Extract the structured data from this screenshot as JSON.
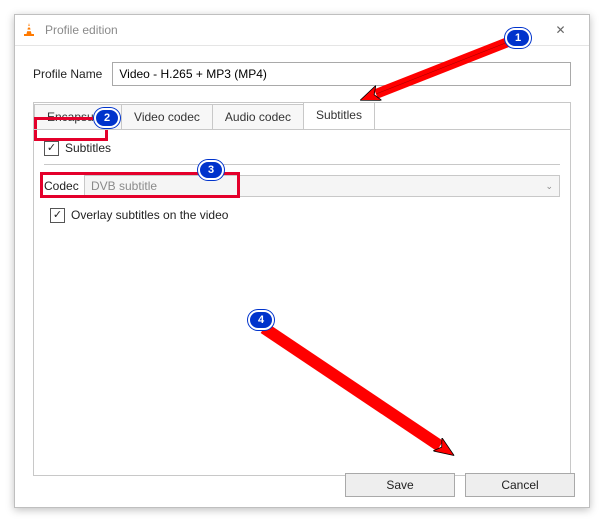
{
  "window": {
    "title": "Profile edition",
    "profile_label": "Profile Name",
    "profile_value": "Video - H.265 + MP3 (MP4)"
  },
  "tabs": {
    "encapsulation": "Encapsulati",
    "video_codec": "Video codec",
    "audio_codec": "Audio codec",
    "subtitles": "Subtitles"
  },
  "subtitles_panel": {
    "subtitles_checkbox_label": "Subtitles",
    "codec_label": "Codec",
    "codec_value": "DVB subtitle",
    "overlay_checkbox_label": "Overlay subtitles on the video"
  },
  "buttons": {
    "save": "Save",
    "cancel": "Cancel"
  },
  "annotations": {
    "b1": "1",
    "b2": "2",
    "b3": "3",
    "b4": "4"
  },
  "icons": {
    "traffic_cone": "vlc-cone-icon",
    "minimize": "–",
    "close": "✕",
    "dropdown": "⌄"
  }
}
